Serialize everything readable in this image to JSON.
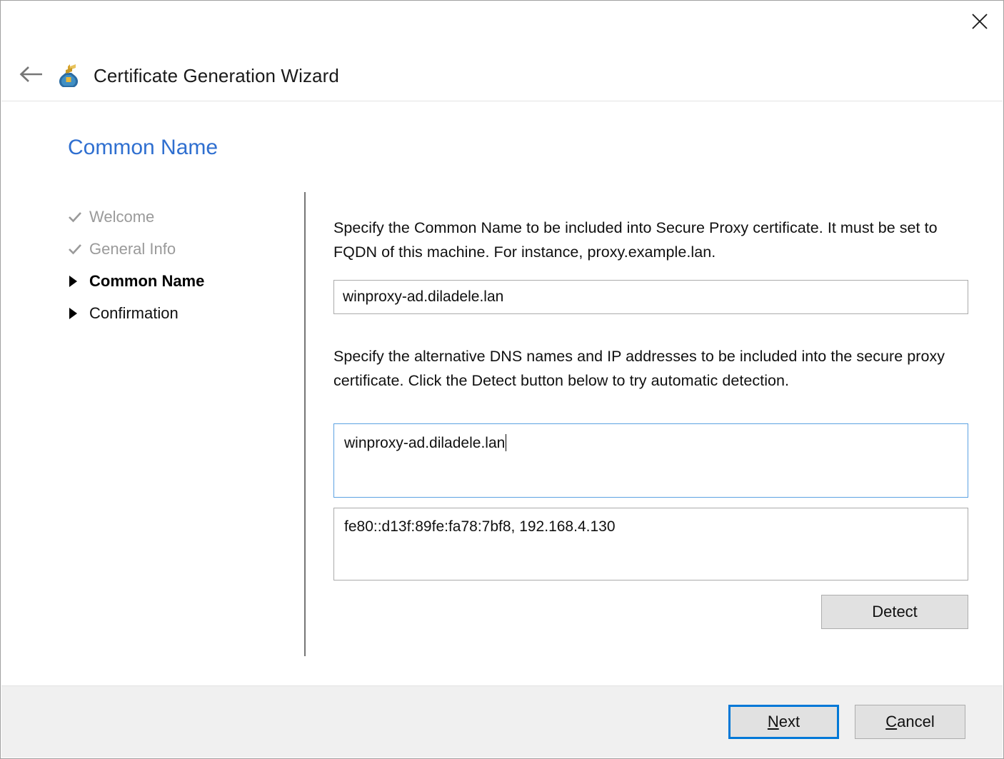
{
  "window": {
    "close_label": "×",
    "close_icon": "close-icon"
  },
  "header": {
    "back_icon": "back-arrow-icon",
    "app_icon": "certificate-wizard-icon",
    "title": "Certificate Generation Wizard"
  },
  "page": {
    "title": "Common Name"
  },
  "steps": [
    {
      "label": "Welcome",
      "state": "completed",
      "marker": "check-icon"
    },
    {
      "label": "General Info",
      "state": "completed",
      "marker": "check-icon"
    },
    {
      "label": "Common Name",
      "state": "current",
      "marker": "triangle-icon"
    },
    {
      "label": "Confirmation",
      "state": "pending",
      "marker": "triangle-icon"
    }
  ],
  "main": {
    "common_name_help": "Specify the Common Name to be included into Secure Proxy certificate. It must be set to FQDN of this machine. For instance, proxy.example.lan.",
    "common_name_value": "winproxy-ad.diladele.lan",
    "common_name_placeholder": "",
    "alt_names_help": "Specify the alternative DNS names and IP addresses to be included into the secure proxy certificate. Click the Detect button below to try automatic detection.",
    "alt_names_value": "winproxy-ad.diladele.lan",
    "alt_names_placeholder": "",
    "detected_addresses_value": "fe80::d13f:89fe:fa78:7bf8, 192.168.4.130",
    "detect_label": "Detect"
  },
  "footer": {
    "next_accel": "N",
    "next_rest": "ext",
    "cancel_accel": "C",
    "cancel_rest": "ancel"
  },
  "colors": {
    "accent": "#0078d7",
    "title_blue": "#2f6fd0",
    "focus_border": "#5ca2e2",
    "field_border": "#ababab",
    "footer_bg": "#f0f0f0",
    "step_done": "#9a9a9a"
  }
}
